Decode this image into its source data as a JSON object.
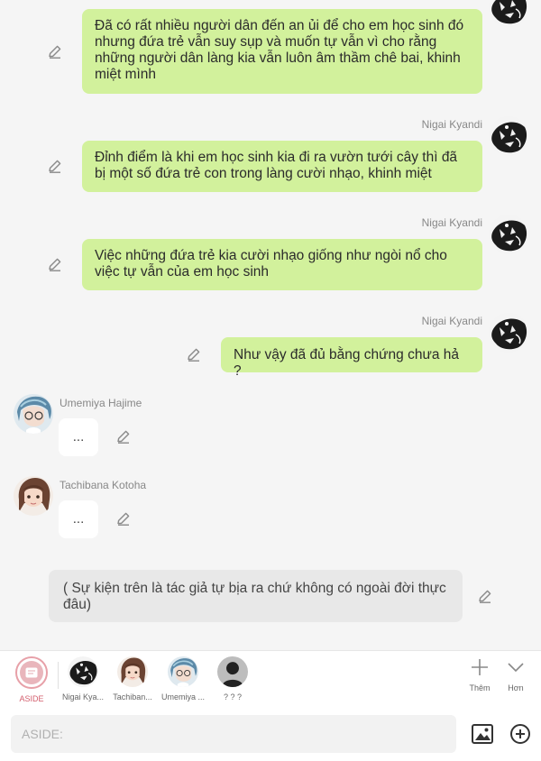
{
  "messages": [
    {
      "sender": "",
      "text": "Đã có rất nhiều người dân đến an ủi để cho em học sinh đó nhưng đứa trẻ vẫn suy sụp và muốn tự vẫn vì cho rằng những người dân làng kia vẫn luôn âm thầm chê bai, khinh miệt mình"
    },
    {
      "sender": "Nigai Kyandi",
      "text": "Đỉnh điểm là khi em học sinh kia đi ra vườn tưới cây thì đã bị một số đứa trẻ con trong làng cười nhạo, khinh miệt"
    },
    {
      "sender": "Nigai Kyandi",
      "text": "Việc những đứa trẻ kia cười nhạo giống như ngòi nổ cho việc tự vẫn của em học sinh"
    },
    {
      "sender": "Nigai Kyandi",
      "text": "Như vậy đã đủ bằng chứng chưa hả ?"
    },
    {
      "sender": "Umemiya Hajime",
      "text": "..."
    },
    {
      "sender": "Tachibana Kotoha",
      "text": "..."
    }
  ],
  "narration": "( Sự kiện trên là tác giả tự bịa ra chứ không có ngoài đời thực đâu)",
  "character_bar": {
    "items": [
      {
        "label": "ASIDE",
        "icon": "aside-icon",
        "selected": true
      },
      {
        "label": "Nigai Kya...",
        "icon": "nigai-avatar"
      },
      {
        "label": "Tachiban...",
        "icon": "tachibana-avatar"
      },
      {
        "label": "Umemiya ...",
        "icon": "umemiya-avatar"
      },
      {
        "label": "? ? ?",
        "icon": "unknown-avatar"
      }
    ],
    "more_label": "Thêm",
    "collapse_label": "Hơn"
  },
  "input": {
    "placeholder": "ASIDE:",
    "value": ""
  },
  "colors": {
    "bubble": "#d2f19c",
    "aside_accent": "#d35f6e",
    "background": "#f5f5f5"
  }
}
